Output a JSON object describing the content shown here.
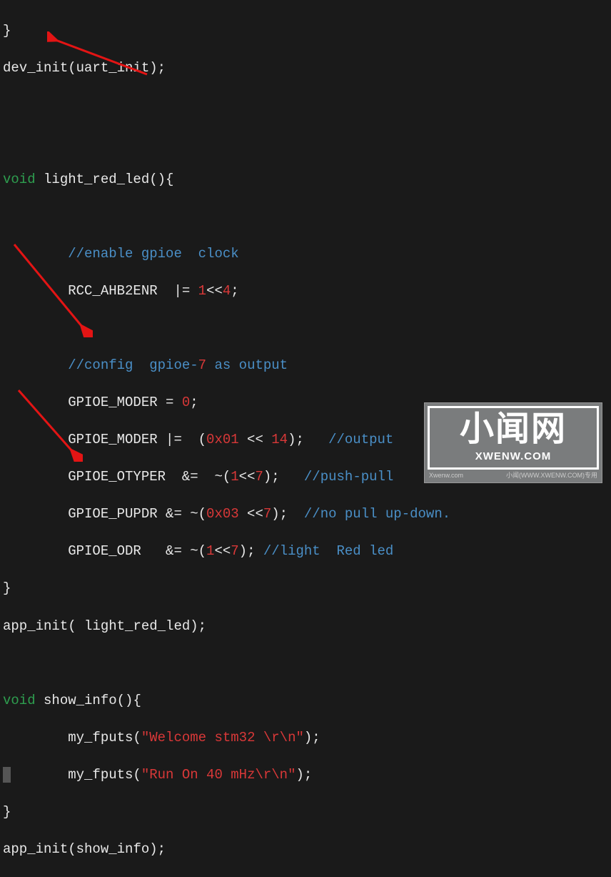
{
  "code": {
    "l1": "}",
    "l2a": "dev_init",
    "l2b": "(",
    "l2c": "uart_init",
    "l2d": ");",
    "l3": "",
    "l4": "",
    "l5a": "void",
    "l5b": " light_red_led",
    "l5c": "(){",
    "l6": "",
    "l7": "        //enable gpioe  clock",
    "l8a": "        RCC_AHB2ENR  |= ",
    "l8b": "1",
    "l8c": "<<",
    "l8d": "4",
    "l8e": ";",
    "l9": "",
    "l10a": "        //config  gpioe-",
    "l10b": "7",
    "l10c": " as output",
    "l11a": "        GPIOE_MODER = ",
    "l11b": "0",
    "l11c": ";",
    "l12a": "        GPIOE_MODER |=  (",
    "l12b": "0x01",
    "l12c": " << ",
    "l12d": "14",
    "l12e": ");   ",
    "l12f": "//output",
    "l13a": "        GPIOE_OTYPER  &=  ~(",
    "l13b": "1",
    "l13c": "<<",
    "l13d": "7",
    "l13e": ");   ",
    "l13f": "//push-pull",
    "l14a": "        GPIOE_PUPDR &= ~(",
    "l14b": "0x03",
    "l14c": " <<",
    "l14d": "7",
    "l14e": ");  ",
    "l14f": "//no pull up-down.",
    "l15a": "        GPIOE_ODR   &= ~(",
    "l15b": "1",
    "l15c": "<<",
    "l15d": "7",
    "l15e": "); ",
    "l15f": "//light  Red led",
    "l16": "}",
    "l17a": "app_init",
    "l17b": "( ",
    "l17c": "light_red_led",
    "l17d": ");",
    "l18": "",
    "l19a": "void",
    "l19b": " show_info",
    "l19c": "(){",
    "l20a": "        my_fputs(",
    "l20b": "\"Welcome stm32 \\r\\n\"",
    "l20c": ");",
    "l21a": "        my_fputs(",
    "l21b": "\"Run On 40 mHz\\r\\n\"",
    "l21c": ");",
    "l22": "}",
    "l23a": "app_init",
    "l23b": "(",
    "l23c": "show_info",
    "l23d": ");"
  },
  "watermark": {
    "cn": "小闻网",
    "en": "XWENW.COM",
    "footer_left": "Xwenw.com",
    "footer_right": "小闻(WWW.XWENW.COM)专用"
  }
}
